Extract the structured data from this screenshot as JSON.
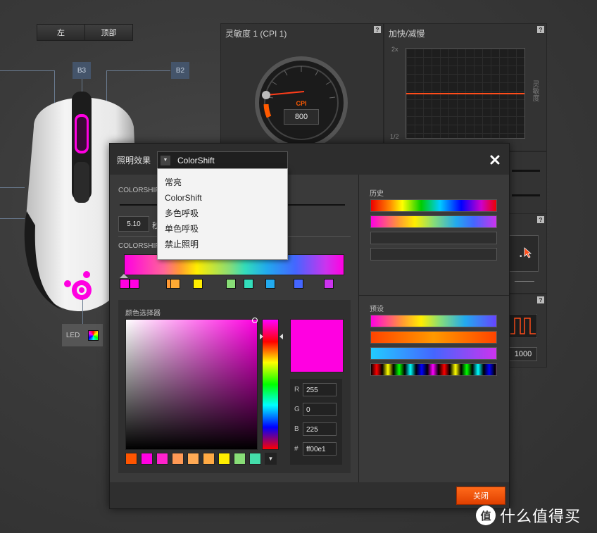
{
  "view_toggle": {
    "left": "左",
    "top": "顶部"
  },
  "mouse_buttons": {
    "b3": "B3",
    "b2": "B2",
    "led": "LED"
  },
  "cpi_panel": {
    "title": "灵敏度 1 (CPI 1)",
    "gauge_label": "CPI",
    "value": "800",
    "help": "?"
  },
  "accel_panel": {
    "title": "加快/减慢",
    "y_top": "2x",
    "y_bottom": "1/2",
    "side_label": "灵敏度",
    "help": "?"
  },
  "polling_panel": {
    "value": "1000",
    "help": "?"
  },
  "dialog": {
    "title": "照明效果",
    "effect_selected": "ColorShift",
    "effect_options": [
      "常亮",
      "ColorShift",
      "多色呼吸",
      "单色呼吸",
      "禁止照明"
    ],
    "close_icon": "close-icon",
    "colorshift_speed_label": "COLORSHIFT",
    "speed_value": "5.10",
    "speed_unit": "秒",
    "colorshift_colors_label": "COLORSHIFT",
    "color_picker_label": "颜色选择器",
    "history_label": "历史",
    "presets_label": "预设",
    "r_label": "R",
    "g_label": "G",
    "b_label": "B",
    "hex_label": "#",
    "r_value": "255",
    "g_value": "0",
    "b_value": "225",
    "hex_value": "ff00e1",
    "close_button": "关闭",
    "selected_color": "#ff00e1",
    "stop_colors": [
      "#ff00e1",
      "#ff00e1",
      "#ff9933",
      "#ffaa33",
      "#ffee00",
      "#88dd77",
      "#33ddbb",
      "#22aaee",
      "#4466ff",
      "#cc33ee"
    ],
    "swatch_colors": [
      "#ff5500",
      "#ff00e1",
      "#ff22cc",
      "#ff9955",
      "#ffaa55",
      "#ffaa44",
      "#ffee00",
      "#88dd77",
      "#44ddaa"
    ]
  },
  "watermark": "值 什么值得买"
}
